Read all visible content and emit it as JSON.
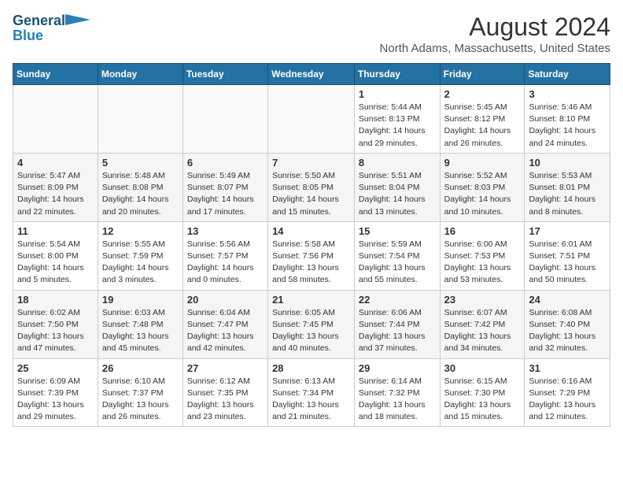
{
  "header": {
    "logo_line1": "General",
    "logo_line2": "Blue",
    "main_title": "August 2024",
    "subtitle": "North Adams, Massachusetts, United States"
  },
  "days_of_week": [
    "Sunday",
    "Monday",
    "Tuesday",
    "Wednesday",
    "Thursday",
    "Friday",
    "Saturday"
  ],
  "weeks": [
    [
      {
        "num": "",
        "info": ""
      },
      {
        "num": "",
        "info": ""
      },
      {
        "num": "",
        "info": ""
      },
      {
        "num": "",
        "info": ""
      },
      {
        "num": "1",
        "info": "Sunrise: 5:44 AM\nSunset: 8:13 PM\nDaylight: 14 hours\nand 29 minutes."
      },
      {
        "num": "2",
        "info": "Sunrise: 5:45 AM\nSunset: 8:12 PM\nDaylight: 14 hours\nand 26 minutes."
      },
      {
        "num": "3",
        "info": "Sunrise: 5:46 AM\nSunset: 8:10 PM\nDaylight: 14 hours\nand 24 minutes."
      }
    ],
    [
      {
        "num": "4",
        "info": "Sunrise: 5:47 AM\nSunset: 8:09 PM\nDaylight: 14 hours\nand 22 minutes."
      },
      {
        "num": "5",
        "info": "Sunrise: 5:48 AM\nSunset: 8:08 PM\nDaylight: 14 hours\nand 20 minutes."
      },
      {
        "num": "6",
        "info": "Sunrise: 5:49 AM\nSunset: 8:07 PM\nDaylight: 14 hours\nand 17 minutes."
      },
      {
        "num": "7",
        "info": "Sunrise: 5:50 AM\nSunset: 8:05 PM\nDaylight: 14 hours\nand 15 minutes."
      },
      {
        "num": "8",
        "info": "Sunrise: 5:51 AM\nSunset: 8:04 PM\nDaylight: 14 hours\nand 13 minutes."
      },
      {
        "num": "9",
        "info": "Sunrise: 5:52 AM\nSunset: 8:03 PM\nDaylight: 14 hours\nand 10 minutes."
      },
      {
        "num": "10",
        "info": "Sunrise: 5:53 AM\nSunset: 8:01 PM\nDaylight: 14 hours\nand 8 minutes."
      }
    ],
    [
      {
        "num": "11",
        "info": "Sunrise: 5:54 AM\nSunset: 8:00 PM\nDaylight: 14 hours\nand 5 minutes."
      },
      {
        "num": "12",
        "info": "Sunrise: 5:55 AM\nSunset: 7:59 PM\nDaylight: 14 hours\nand 3 minutes."
      },
      {
        "num": "13",
        "info": "Sunrise: 5:56 AM\nSunset: 7:57 PM\nDaylight: 14 hours\nand 0 minutes."
      },
      {
        "num": "14",
        "info": "Sunrise: 5:58 AM\nSunset: 7:56 PM\nDaylight: 13 hours\nand 58 minutes."
      },
      {
        "num": "15",
        "info": "Sunrise: 5:59 AM\nSunset: 7:54 PM\nDaylight: 13 hours\nand 55 minutes."
      },
      {
        "num": "16",
        "info": "Sunrise: 6:00 AM\nSunset: 7:53 PM\nDaylight: 13 hours\nand 53 minutes."
      },
      {
        "num": "17",
        "info": "Sunrise: 6:01 AM\nSunset: 7:51 PM\nDaylight: 13 hours\nand 50 minutes."
      }
    ],
    [
      {
        "num": "18",
        "info": "Sunrise: 6:02 AM\nSunset: 7:50 PM\nDaylight: 13 hours\nand 47 minutes."
      },
      {
        "num": "19",
        "info": "Sunrise: 6:03 AM\nSunset: 7:48 PM\nDaylight: 13 hours\nand 45 minutes."
      },
      {
        "num": "20",
        "info": "Sunrise: 6:04 AM\nSunset: 7:47 PM\nDaylight: 13 hours\nand 42 minutes."
      },
      {
        "num": "21",
        "info": "Sunrise: 6:05 AM\nSunset: 7:45 PM\nDaylight: 13 hours\nand 40 minutes."
      },
      {
        "num": "22",
        "info": "Sunrise: 6:06 AM\nSunset: 7:44 PM\nDaylight: 13 hours\nand 37 minutes."
      },
      {
        "num": "23",
        "info": "Sunrise: 6:07 AM\nSunset: 7:42 PM\nDaylight: 13 hours\nand 34 minutes."
      },
      {
        "num": "24",
        "info": "Sunrise: 6:08 AM\nSunset: 7:40 PM\nDaylight: 13 hours\nand 32 minutes."
      }
    ],
    [
      {
        "num": "25",
        "info": "Sunrise: 6:09 AM\nSunset: 7:39 PM\nDaylight: 13 hours\nand 29 minutes."
      },
      {
        "num": "26",
        "info": "Sunrise: 6:10 AM\nSunset: 7:37 PM\nDaylight: 13 hours\nand 26 minutes."
      },
      {
        "num": "27",
        "info": "Sunrise: 6:12 AM\nSunset: 7:35 PM\nDaylight: 13 hours\nand 23 minutes."
      },
      {
        "num": "28",
        "info": "Sunrise: 6:13 AM\nSunset: 7:34 PM\nDaylight: 13 hours\nand 21 minutes."
      },
      {
        "num": "29",
        "info": "Sunrise: 6:14 AM\nSunset: 7:32 PM\nDaylight: 13 hours\nand 18 minutes."
      },
      {
        "num": "30",
        "info": "Sunrise: 6:15 AM\nSunset: 7:30 PM\nDaylight: 13 hours\nand 15 minutes."
      },
      {
        "num": "31",
        "info": "Sunrise: 6:16 AM\nSunset: 7:29 PM\nDaylight: 13 hours\nand 12 minutes."
      }
    ]
  ]
}
